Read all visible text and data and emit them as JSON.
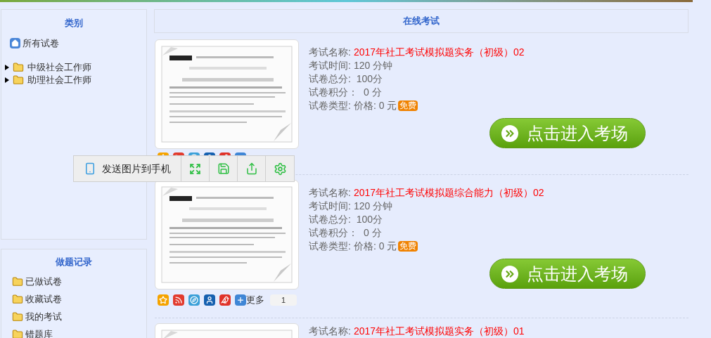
{
  "sidebar": {
    "category_panel": {
      "title": "类别",
      "all_item": "所有试卷",
      "tree": [
        {
          "label": "中级社会工作师",
          "expanded": false
        },
        {
          "label": "助理社会工作师",
          "expanded": false
        }
      ]
    },
    "records_panel": {
      "title": "做题记录",
      "items": [
        "已做试卷",
        "收藏试卷",
        "我的考试",
        "错题库"
      ]
    }
  },
  "main": {
    "title": "在线考试",
    "exams": [
      {
        "fields": [
          {
            "label": "考试名称:",
            "value": "2017年社工考试模拟题实务（初级）02",
            "kind": "title"
          },
          {
            "label": "考试时间:",
            "value": "120 分钟",
            "kind": "plain"
          },
          {
            "label": "试卷总分:",
            "value": " 100分",
            "kind": "plain"
          },
          {
            "label": "试卷积分：",
            "value": " 0 分",
            "kind": "plain"
          },
          {
            "label": "试卷类型:",
            "value": "价格: 0 元",
            "kind": "plain",
            "badge": "免费"
          }
        ],
        "button": "点击进入考场",
        "share_row": true
      },
      {
        "fields": [
          {
            "label": "考试名称:",
            "value": "2017年社工考试模拟题综合能力（初级）02",
            "kind": "title"
          },
          {
            "label": "考试时间:",
            "value": "120 分钟",
            "kind": "plain"
          },
          {
            "label": "试卷总分:",
            "value": " 100分",
            "kind": "plain"
          },
          {
            "label": "试卷积分：",
            "value": " 0 分",
            "kind": "plain"
          },
          {
            "label": "试卷类型:",
            "value": "价格: 0 元",
            "kind": "plain",
            "badge": "免费"
          }
        ],
        "button": "点击进入考场",
        "share_row": true,
        "share_more": "更多",
        "share_count": "1"
      },
      {
        "fields": [
          {
            "label": "考试名称:",
            "value": "2017年社工考试模拟题实务（初级）01",
            "kind": "title"
          }
        ]
      }
    ]
  },
  "image_toolbar": {
    "send_label": "发送图片到手机"
  }
}
